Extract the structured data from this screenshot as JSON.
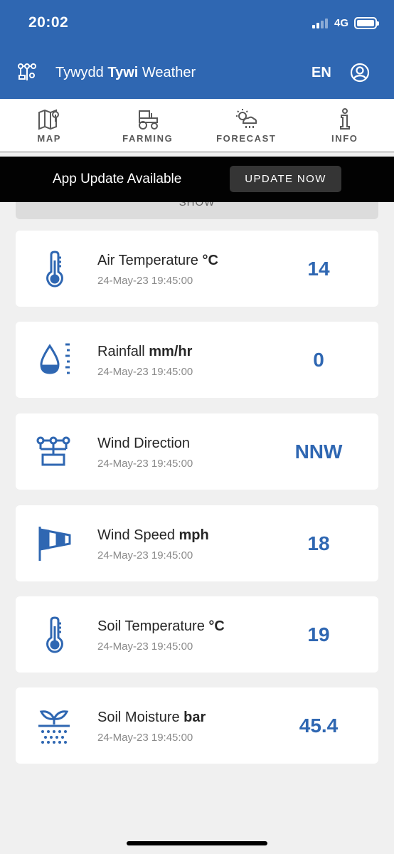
{
  "status": {
    "time": "20:02",
    "network": "4G"
  },
  "header": {
    "title_prefix": "Tywydd ",
    "title_bold": "Tywi",
    "title_suffix": " Weather",
    "language": "EN"
  },
  "tabs": [
    {
      "label": "MAP",
      "icon": "map-icon"
    },
    {
      "label": "FARMING",
      "icon": "tractor-icon"
    },
    {
      "label": "FORECAST",
      "icon": "weather-forecast-icon"
    },
    {
      "label": "INFO",
      "icon": "info-icon"
    }
  ],
  "update_banner": {
    "text": "App Update Available",
    "button": "UPDATE NOW"
  },
  "collapsed_label": "SHOW",
  "readings": [
    {
      "name": "Air Temperature ",
      "unit": "°C",
      "time": "24-May-23 19:45:00",
      "value": "14",
      "icon": "thermometer-icon"
    },
    {
      "name": "Rainfall ",
      "unit": "mm/hr",
      "time": "24-May-23 19:45:00",
      "value": "0",
      "icon": "rain-gauge-icon"
    },
    {
      "name": "Wind Direction",
      "unit": "",
      "time": "24-May-23 19:45:00",
      "value": "NNW",
      "icon": "wind-vane-icon"
    },
    {
      "name": "Wind Speed ",
      "unit": "mph",
      "time": "24-May-23 19:45:00",
      "value": "18",
      "icon": "windsock-icon"
    },
    {
      "name": "Soil Temperature ",
      "unit": "°C",
      "time": "24-May-23 19:45:00",
      "value": "19",
      "icon": "thermometer-icon"
    },
    {
      "name": "Soil Moisture ",
      "unit": "bar",
      "time": "24-May-23 19:45:00",
      "value": "45.4",
      "icon": "soil-moisture-icon"
    }
  ],
  "colors": {
    "brand": "#2f67b2",
    "banner": "#020202"
  }
}
